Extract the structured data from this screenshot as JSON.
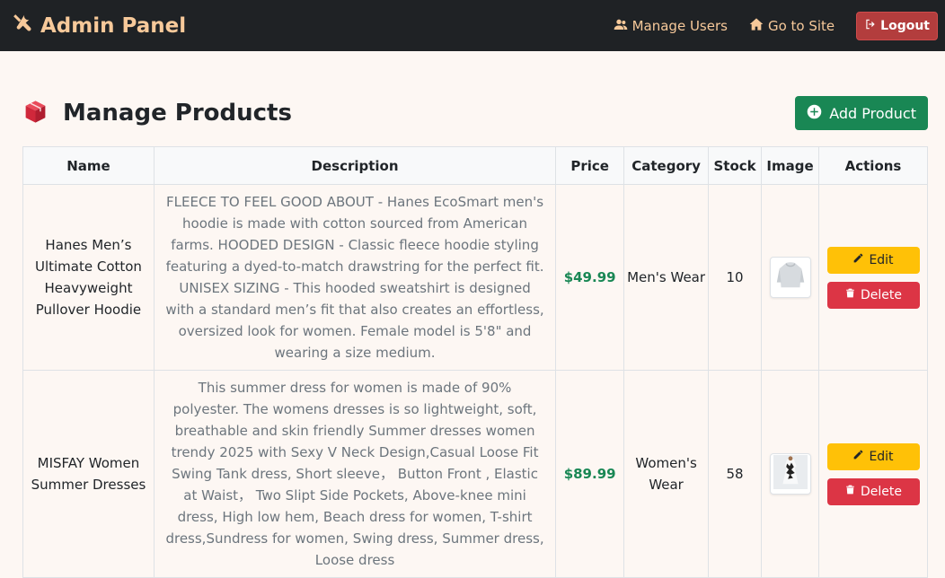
{
  "navbar": {
    "brand": "Admin Panel",
    "manage_users": "Manage Users",
    "go_to_site": "Go to Site",
    "logout": "Logout"
  },
  "page": {
    "title": "Manage Products",
    "add_button": "Add Product"
  },
  "table": {
    "headers": [
      "Name",
      "Description",
      "Price",
      "Category",
      "Stock",
      "Image",
      "Actions"
    ],
    "rows": [
      {
        "name": "Hanes Men’s Ultimate Cotton Heavyweight Pullover Hoodie",
        "description": "FLEECE TO FEEL GOOD ABOUT - Hanes EcoSmart men's hoodie is made with cotton sourced from American farms. HOODED DESIGN - Classic fleece hoodie styling featuring a dyed-to-match drawstring for the perfect fit. UNISEX SIZING - This hooded sweatshirt is designed with a standard men’s fit that also creates an effortless, oversized look for women. Female model is 5'8\" and wearing a size medium.",
        "price": "$49.99",
        "category": "Men's Wear",
        "stock": "10",
        "image_icon": "hoodie-thumbnail",
        "edit_label": "Edit",
        "delete_label": "Delete"
      },
      {
        "name": "MISFAY Women Summer Dresses",
        "description": "This summer dress for women is made of 90% polyester. The womens dresses is so lightweight, soft, breathable and skin friendly Summer dresses women trendy 2025 with Sexy V Neck Design,Casual Loose Fit Swing Tank dress, Short sleeve， Button Front , Elastic at Waist， Two Slipt Side Pockets, Above-knee mini dress, High low hem, Beach dress for women, T-shirt dress,Sundress for women, Swing dress, Summer dress, Loose dress",
        "price": "$89.99",
        "category": "Women's Wear",
        "stock": "58",
        "image_icon": "dress-thumbnail",
        "edit_label": "Edit",
        "delete_label": "Delete"
      }
    ]
  },
  "colors": {
    "navbar_bg": "#1f2225",
    "brand": "#f7c99a",
    "logout": "#b33d3d",
    "add": "#198754",
    "price": "#198754",
    "edit": "#ffc107",
    "delete": "#dc3545"
  }
}
